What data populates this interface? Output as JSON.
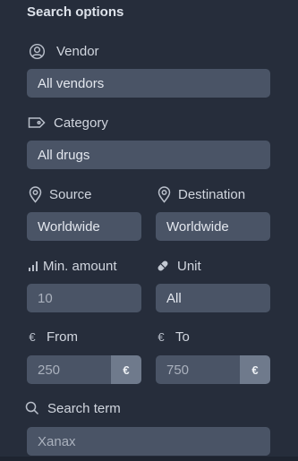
{
  "panel": {
    "title": "Search options",
    "vendor": {
      "label": "Vendor",
      "value": "All vendors",
      "icon": "user-circle-icon"
    },
    "category": {
      "label": "Category",
      "value": "All drugs",
      "icon": "tag-icon"
    },
    "source": {
      "label": "Source",
      "value": "Worldwide",
      "icon": "location-pin-icon"
    },
    "destination": {
      "label": "Destination",
      "value": "Worldwide",
      "icon": "location-pin-icon"
    },
    "min_amount": {
      "label": "Min. amount",
      "placeholder": "10",
      "icon": "bar-chart-icon"
    },
    "unit": {
      "label": "Unit",
      "value": "All",
      "icon": "pill-icon"
    },
    "price_from": {
      "label": "From",
      "placeholder": "250",
      "currency": "€",
      "icon": "euro-icon"
    },
    "price_to": {
      "label": "To",
      "placeholder": "750",
      "currency": "€",
      "icon": "euro-icon"
    },
    "search_term": {
      "label": "Search term",
      "placeholder": "Xanax",
      "icon": "search-icon"
    }
  },
  "colors": {
    "background": "#262d3b",
    "field": "#4a5466",
    "addon": "#6f7a8c",
    "text": "#d1d6df"
  }
}
